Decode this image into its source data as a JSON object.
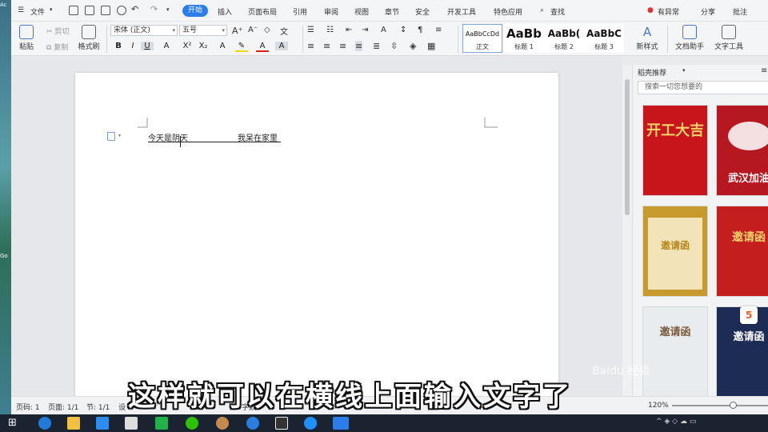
{
  "desktop": {
    "labels": [
      "Ac",
      "Go",
      "Go"
    ]
  },
  "menu": {
    "file": "文件",
    "tabs": [
      "开始",
      "插入",
      "页面布局",
      "引用",
      "审阅",
      "视图",
      "章节",
      "安全",
      "开发工具",
      "特色应用"
    ],
    "search": "查找",
    "right": {
      "anomaly": "有异常",
      "share": "分享",
      "comment": "批注"
    }
  },
  "ribbon": {
    "paste": "粘贴",
    "cut": "剪切",
    "copy": "复制",
    "format_painter": "格式刷",
    "font_name": "宋体 (正文)",
    "font_size": "五号",
    "styles": [
      {
        "sample": "AaBbCcDd",
        "name": "正文"
      },
      {
        "sample": "AaBb",
        "name": "标题 1"
      },
      {
        "sample": "AaBb(",
        "name": "标题 2"
      },
      {
        "sample": "AaBbC",
        "name": "标题 3"
      }
    ],
    "new_style": "新样式",
    "doc_helper": "文档助手",
    "text_tools": "文字工具"
  },
  "document": {
    "text_left": "今天是阴天",
    "text_right": "我呆在家里"
  },
  "right_pane": {
    "title": "稻壳推荐",
    "search_placeholder": "搜索一切您想要的",
    "templates": [
      {
        "title": "开工大吉",
        "color": "#c8141b"
      },
      {
        "title": "武汉加油",
        "color": "#b51820"
      },
      {
        "title": "邀请函",
        "color": "#c79a2e"
      },
      {
        "title": "邀请函",
        "color": "#c41e1e"
      },
      {
        "title": "邀请函",
        "color": "#e8ecef"
      },
      {
        "title": "邀请函",
        "color": "#1d2c55"
      }
    ]
  },
  "subtitle": "这样就可以在横线上面输入文字了",
  "status": {
    "page_no": "页码: 1",
    "page_of": "页面: 1/1",
    "section": "节: 1/1",
    "settings": "设",
    "words": "字数",
    "zoom": "120%"
  },
  "watermark": "Baidu 经验"
}
